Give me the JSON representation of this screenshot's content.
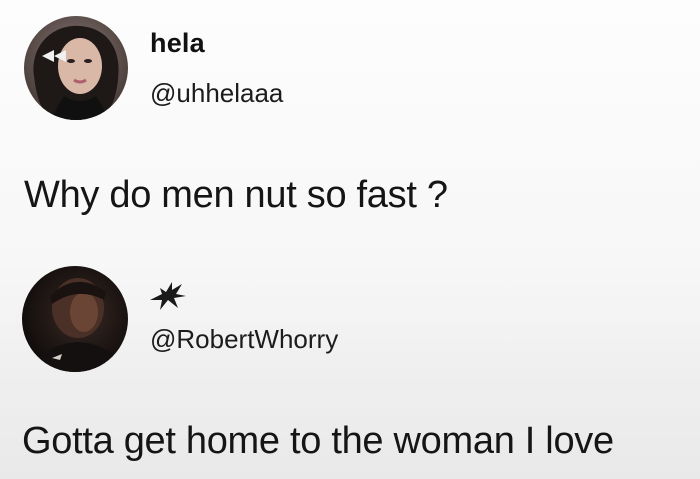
{
  "tweets": [
    {
      "display_name": "hela",
      "handle": "@uhhelaaa",
      "text": "Why do men nut so fast ?",
      "avatar_icon": "profile-photo-woman"
    },
    {
      "display_name_icon": "bird-emblem-icon",
      "handle": "@RobertWhorry",
      "text": "Gotta get home to the woman I love",
      "avatar_icon": "profile-photo-man"
    }
  ],
  "colors": {
    "text": "#111111",
    "background": "#fbfbfb"
  }
}
